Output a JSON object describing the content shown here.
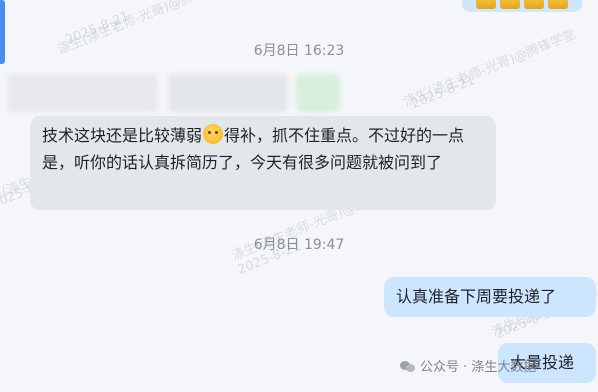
{
  "timestamps": [
    "6月8日 16:23",
    "6月8日 19:47"
  ],
  "messages": [
    {
      "side": "in",
      "text_before": "技术这块还是比较薄弱",
      "emoji": "pleading-face",
      "text_after": "得补，抓不住重点。不过好的一点是，听你的话认真拆简历了，今天有很多问题就被问到了"
    },
    {
      "side": "out",
      "text": "认真准备下周要投递了"
    },
    {
      "side": "out",
      "text": "大量投递"
    }
  ],
  "watermarks": [
    "涤生(涤生老师-光哥)@腾锋学堂",
    "2025-8-21",
    "涤生(涤生老师-光哥)@腾锋学堂",
    "2025-8-21",
    "涤生(涤生老师-光哥)@腾锋学堂",
    "2025-8-21",
    "涤生(涤生老师-光哥)@腾锋学堂",
    "2025-8-21",
    "涤生(涤生老师-光哥)@腾锋学堂",
    "2025-8-21"
  ],
  "footer": {
    "label": "公众号 · 涤生大数据"
  },
  "colors": {
    "incoming_bubble": "#e3e6ea",
    "outgoing_bubble": "#cde6ff",
    "accent": "#4a8cf0",
    "background": "#f4f6f9"
  }
}
